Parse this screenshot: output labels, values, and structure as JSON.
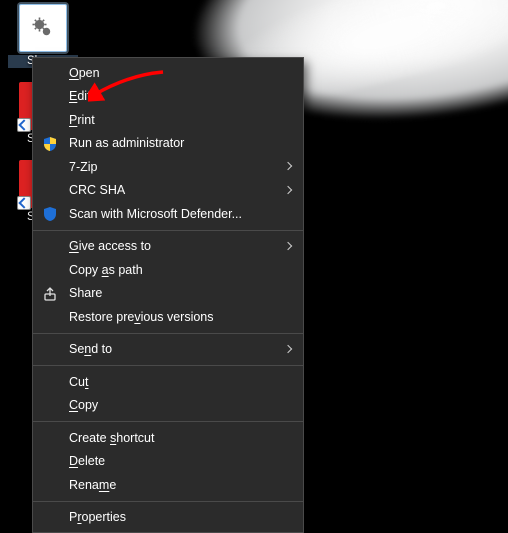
{
  "desktop": {
    "icons": [
      {
        "label": "Shu…",
        "selected": true,
        "type": "gear"
      },
      {
        "label": "Shu…",
        "selected": false,
        "type": "red"
      },
      {
        "label": "Shu…",
        "selected": false,
        "type": "red"
      }
    ]
  },
  "context_menu": {
    "groups": [
      [
        {
          "label": "Open",
          "accel": "O",
          "icon": null,
          "submenu": false
        },
        {
          "label": "Edit",
          "accel": "E",
          "icon": null,
          "submenu": false,
          "pointed": true
        },
        {
          "label": "Print",
          "accel": "P",
          "icon": null,
          "submenu": false
        },
        {
          "label": "Run as administrator",
          "accel": null,
          "icon": "shield-admin",
          "submenu": false
        },
        {
          "label": "7-Zip",
          "accel": null,
          "icon": null,
          "submenu": true
        },
        {
          "label": "CRC SHA",
          "accel": null,
          "icon": null,
          "submenu": true
        },
        {
          "label": "Scan with Microsoft Defender...",
          "accel": null,
          "icon": "shield-defender",
          "submenu": false
        }
      ],
      [
        {
          "label": "Give access to",
          "accel": "G",
          "icon": null,
          "submenu": true
        },
        {
          "label": "Copy as path",
          "accel": "a",
          "icon": null,
          "submenu": false
        },
        {
          "label": "Share",
          "accel": null,
          "icon": "share",
          "submenu": false
        },
        {
          "label": "Restore previous versions",
          "accel": "v",
          "icon": null,
          "submenu": false
        }
      ],
      [
        {
          "label": "Send to",
          "accel": "n",
          "icon": null,
          "submenu": true
        }
      ],
      [
        {
          "label": "Cut",
          "accel": "t",
          "icon": null,
          "submenu": false
        },
        {
          "label": "Copy",
          "accel": "C",
          "icon": null,
          "submenu": false
        }
      ],
      [
        {
          "label": "Create shortcut",
          "accel": "s",
          "icon": null,
          "submenu": false
        },
        {
          "label": "Delete",
          "accel": "D",
          "icon": null,
          "submenu": false
        },
        {
          "label": "Rename",
          "accel": "m",
          "icon": null,
          "submenu": false
        }
      ],
      [
        {
          "label": "Properties",
          "accel": "R",
          "icon": null,
          "submenu": false
        }
      ]
    ]
  },
  "annotation": {
    "arrow_color": "#ff0000"
  }
}
